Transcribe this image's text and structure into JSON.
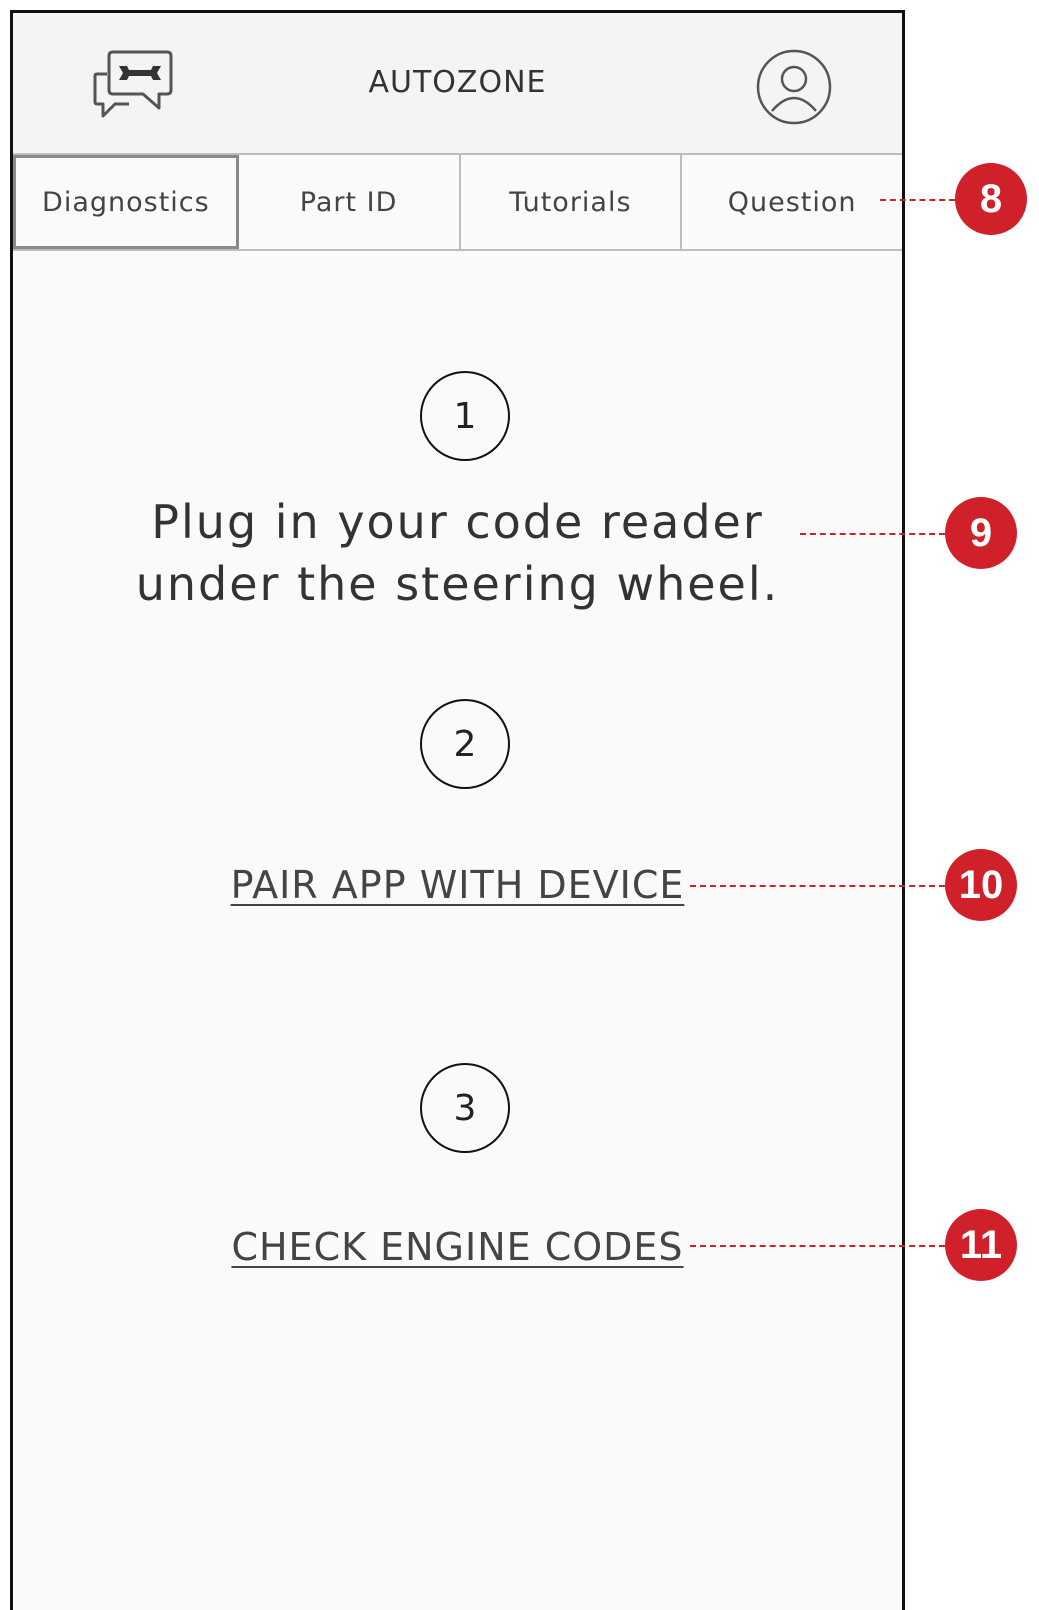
{
  "header": {
    "title": "AUTOZONE",
    "left_icon": "chat-wrench-icon",
    "right_icon": "profile-icon"
  },
  "tabs": [
    {
      "label": "Diagnostics",
      "active": true
    },
    {
      "label": "Part ID",
      "active": false
    },
    {
      "label": "Tutorials",
      "active": false
    },
    {
      "label": "Question",
      "active": false
    }
  ],
  "steps": [
    {
      "number": "1",
      "text_line1": "Plug in your code reader",
      "text_line2": "under the steering wheel."
    },
    {
      "number": "2",
      "link": "PAIR APP WITH DEVICE"
    },
    {
      "number": "3",
      "link": "CHECK ENGINE CODES"
    }
  ],
  "callouts": [
    "8",
    "9",
    "10",
    "11"
  ],
  "colors": {
    "callout": "#d0202a",
    "text": "#333333"
  }
}
